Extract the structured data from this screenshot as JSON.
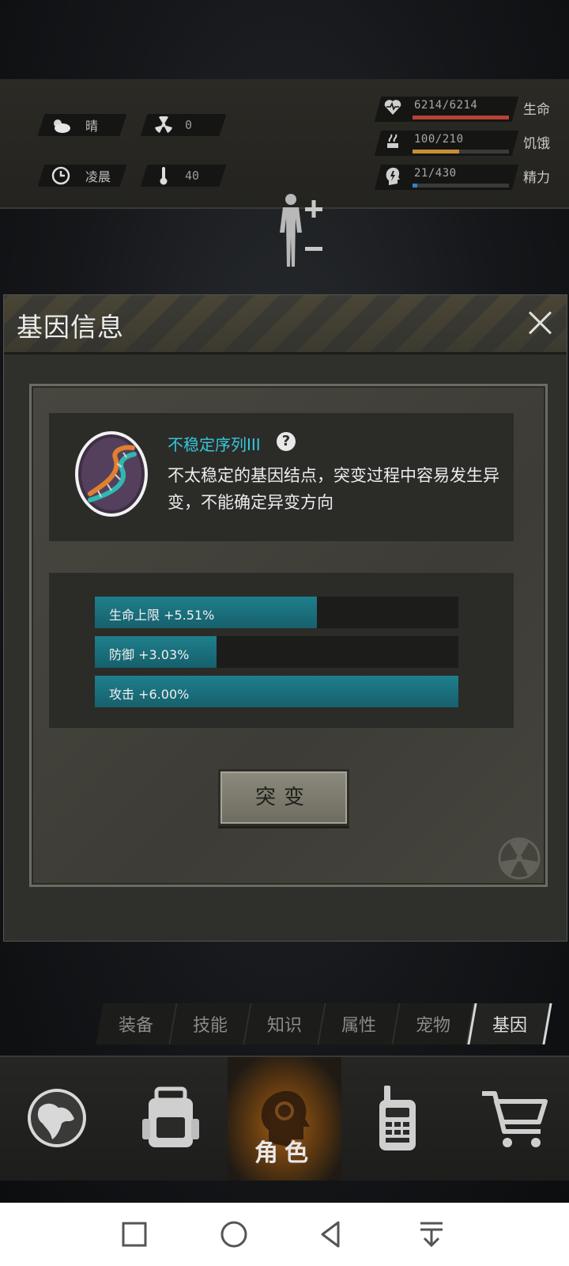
{
  "status": {
    "weather_label": "晴",
    "radiation_value": "0",
    "time_label": "凌晨",
    "temperature_value": "40",
    "health": {
      "text": "6214/6214",
      "name": "生命",
      "fill": 1.0,
      "color": "#b84235"
    },
    "hunger": {
      "text": "100/210",
      "name": "饥饿",
      "fill": 0.48,
      "color": "#c79034"
    },
    "energy": {
      "text": "21/430",
      "name": "精力",
      "fill": 0.05,
      "color": "#3a7fc0"
    }
  },
  "dialog": {
    "title": "基因信息",
    "gene_name": "不稳定序列III",
    "help_symbol": "?",
    "description": "不太稳定的基因结点，突变过程中容易发生异变，不能确定异变方向",
    "stats": [
      {
        "label": "生命上限 +5.51%",
        "fill": 0.61
      },
      {
        "label": "防御 +3.03%",
        "fill": 0.335
      },
      {
        "label": "攻击 +6.00%",
        "fill": 1.0
      }
    ],
    "mutate_label": "突变"
  },
  "tabs": [
    "装备",
    "技能",
    "知识",
    "属性",
    "宠物",
    "基因"
  ],
  "active_tab": "基因",
  "bottom_nav": {
    "active_label": "角色",
    "items": [
      "map-globe",
      "backpack",
      "character",
      "radio",
      "shop-cart"
    ]
  }
}
